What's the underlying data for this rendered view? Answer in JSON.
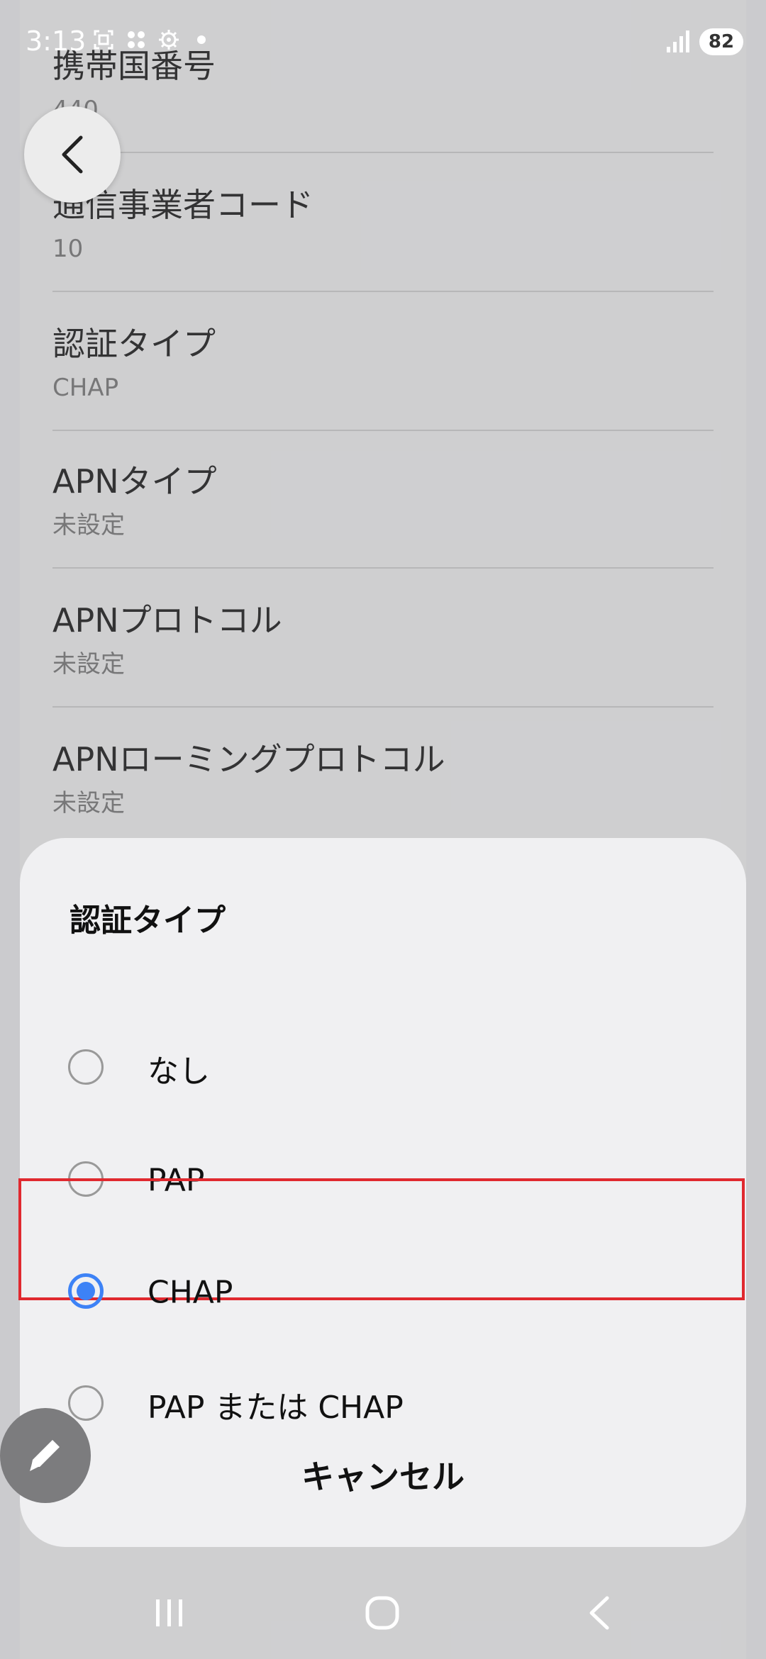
{
  "status_bar": {
    "time": "3:13",
    "battery": "82",
    "icons": [
      "screenshot-icon",
      "apps-grid-icon",
      "gear-icon",
      "notification-dot",
      "signal-icon"
    ]
  },
  "list": {
    "items": [
      {
        "title": "携帯国番号",
        "value": "440"
      },
      {
        "title": "通信事業者コード",
        "value": "10"
      },
      {
        "title": "認証タイプ",
        "value": "CHAP"
      },
      {
        "title": "APNタイプ",
        "value": "未設定"
      },
      {
        "title": "APNプロトコル",
        "value": "未設定"
      },
      {
        "title": "APNローミングプロトコル",
        "value": "未設定"
      }
    ]
  },
  "dialog": {
    "title": "認証タイプ",
    "options": [
      {
        "label": "なし",
        "checked": false
      },
      {
        "label": "PAP",
        "checked": false
      },
      {
        "label": "CHAP",
        "checked": true
      },
      {
        "label": "PAP または CHAP",
        "checked": false
      }
    ],
    "cancel_label": "キャンセル"
  },
  "colors": {
    "accent": "#3d82f6",
    "highlight": "#e0292f"
  },
  "icons": {
    "back": "back-arrow-icon",
    "fab": "pencil-icon",
    "nav": [
      "recents-icon",
      "home-icon",
      "back-icon"
    ]
  }
}
